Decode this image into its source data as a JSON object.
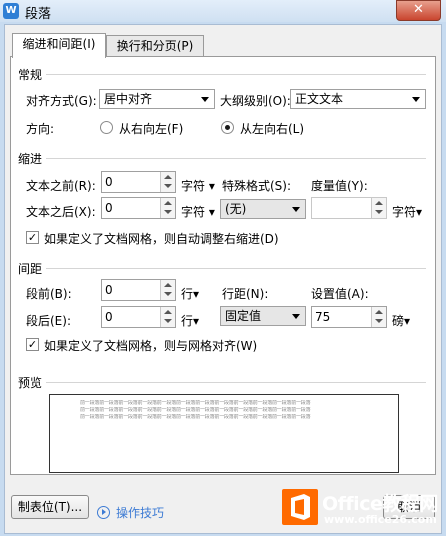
{
  "window": {
    "title": "段落",
    "app_icon": "W",
    "close_glyph": "✕"
  },
  "tabs": [
    {
      "label": "缩进和间距(I)"
    },
    {
      "label": "换行和分页(P)"
    }
  ],
  "general": {
    "section": "常规",
    "alignment_label": "对齐方式(G):",
    "alignment_value": "居中对齐",
    "outline_label": "大纲级别(O):",
    "outline_value": "正文文本",
    "direction_label": "方向:",
    "rtl_label": "从右向左(F)",
    "ltr_label": "从左向右(L)",
    "selected_direction": "ltr"
  },
  "indent": {
    "section": "缩进",
    "before_label": "文本之前(R):",
    "before_value": "0",
    "before_unit": "字符",
    "after_label": "文本之后(X):",
    "after_value": "0",
    "after_unit": "字符",
    "special_label": "特殊格式(S):",
    "special_value": "(无)",
    "measure_label": "度量值(Y):",
    "measure_value": "",
    "measure_unit": "字符",
    "grid_check_label": "如果定义了文档网格，则自动调整右缩进(D)",
    "grid_checked": true
  },
  "spacing": {
    "section": "间距",
    "before_label": "段前(B):",
    "before_value": "0",
    "before_unit": "行",
    "after_label": "段后(E):",
    "after_value": "0",
    "after_unit": "行",
    "line_label": "行距(N):",
    "line_value": "固定值",
    "setting_label": "设置值(A):",
    "setting_value": "75",
    "setting_unit": "磅",
    "grid_check_label": "如果定义了文档网格，则与网格对齐(W)",
    "grid_checked": true
  },
  "preview": {
    "section": "预览",
    "lines": [
      "前一段落前一段落前一段落前一段落前一段落前一段落前一段落前一段落前一段落前一段落前一段落前一段落",
      "前一段落前一段落前一段落前一段落前一段落前一段落前一段落前一段落前一段落前一段落前一段落前一段落",
      "前一段落前一段落前一段落前一段落前一段落前一段落前一段落前一段落前一段落前一段落前一段落前一段落"
    ]
  },
  "footer": {
    "tabs_button": "制表位(T)...",
    "tips_label": "操作技巧",
    "cancel_button": "取消"
  },
  "watermark": {
    "line1": "Office教程网",
    "line2": "www.office26.com",
    "accent": "#ff6a00"
  }
}
